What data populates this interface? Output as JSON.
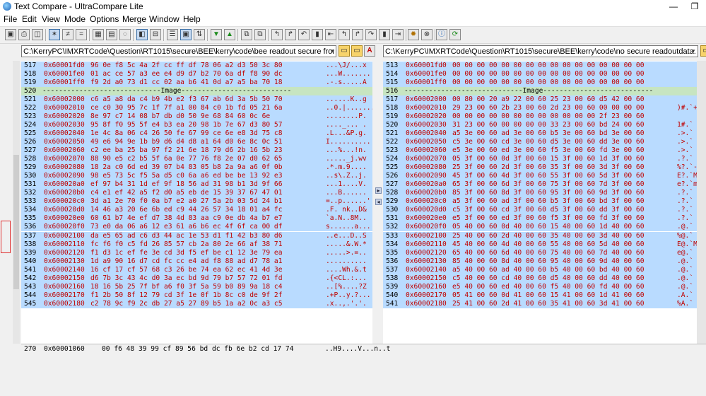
{
  "window": {
    "title": "Text Compare - UltraCompare Lite",
    "restore_glyph": "❐"
  },
  "menu": [
    "File",
    "Edit",
    "View",
    "Mode",
    "Options",
    "Merge",
    "Window",
    "Help"
  ],
  "toolbar": {
    "icons": [
      "save-icon",
      "print-icon",
      "print-preview-icon",
      "show-all-icon",
      "show-differences-icon",
      "show-matches-icon",
      "binary-view-icon",
      "hex-view-icon",
      "ignore-options-icon",
      "side-by-side-icon",
      "over-under-icon",
      "swap-icon",
      "sync-icon",
      "list-view-icon",
      "swap-panes-icon",
      "next-difference-icon",
      "previous-difference-icon",
      "first-difference-icon",
      "copy-left-icon",
      "copy-right-icon",
      "undo-icon",
      "save-left-icon",
      "merge-left-icon",
      "merge-right-icon",
      "lock-icon",
      "open-icon",
      "tools-icon",
      "stop-icon",
      "info-icon",
      "refresh-icon"
    ]
  },
  "left": {
    "path": "C:\\KerryPC\\IMXRTCode\\Question\\RT1015\\secure\\BEE\\kerry\\code\\bee readout secure from 0x60001000len"
  },
  "right": {
    "path": "C:\\KerryPC\\IMXRTCode\\Question\\RT1015\\secure\\BEE\\kerry\\code\\no secure readoutdata.txt"
  },
  "colors": {
    "highlight_row": "#b9dbff",
    "image_row": "#c7e5c1",
    "diff_text": "#c00000"
  },
  "left_rows": [
    {
      "ln": "517",
      "addr": "0x60001fd0",
      "hex": "96 0e f8 5c 4a 2f cc ff df 78 06 a2 d3 50 3c 80",
      "asc": "...\\J/...x",
      "type": "hl"
    },
    {
      "ln": "518",
      "addr": "0x60001fe0",
      "hex": "01 ac ce 57 a3 ee e4 d9 d7 b2 70 6a df f8 90 dc",
      "asc": "...W.......",
      "type": "hl"
    },
    {
      "ln": "519",
      "addr": "0x60001ff0",
      "hex": "f9 2d a0 73 d1 cc 02 aa b6 41 0d a7 a5 ba 70 18",
      "asc": ".-.s.....A",
      "type": "hl"
    },
    {
      "ln": "520",
      "addr": "",
      "hex": "-----------------------------Image---------------------------",
      "asc": "",
      "type": "img"
    },
    {
      "ln": "521",
      "addr": "0x60002000",
      "hex": "c6 a5 a8 da c4 b9 4b e2 f3 67 ab 6d 3a 5b 50 70",
      "asc": "......K..g",
      "type": "hl"
    },
    {
      "ln": "522",
      "addr": "0x60002010",
      "hex": "ce c0 30 95 7c 1f 7f a1 00 84 c0 1b fd 05 21 6a",
      "asc": "..0.|.......",
      "type": "hl"
    },
    {
      "ln": "523",
      "addr": "0x60002020",
      "hex": "8e 97 c7 14 08 b7 db d0 50 9e 68 84 60 0c 6e",
      "asc": "........P.",
      "type": "hl"
    },
    {
      "ln": "524",
      "addr": "0x60002030",
      "hex": "95 8f f0 95 5f e4 b3 ea 20 98 1b 7e 67 d3 80 57",
      "asc": "...._... .",
      "type": "hl"
    },
    {
      "ln": "525",
      "addr": "0x60002040",
      "hex": "1e 4c 8a 06 c4 26 50 fe 67 99 ce 6e e8 3d 75 c8",
      "asc": ".L...&P.g.",
      "type": "hl"
    },
    {
      "ln": "526",
      "addr": "0x60002050",
      "hex": "49 e6 94 9e 1b b9 d6 d4 d8 a1 64 d0 6e 8c 0c 51",
      "asc": "I..........",
      "type": "hl"
    },
    {
      "ln": "527",
      "addr": "0x60002060",
      "hex": "c2 ee ba 25 ba 97 f2 21 6e 18 79 d6 2b 16 5b 23",
      "asc": "...%...!n.",
      "type": "hl"
    },
    {
      "ln": "528",
      "addr": "0x60002070",
      "hex": "88 90 e5 c2 b5 5f 6a 0e 77 76 f8 2e 07 d0 62 65",
      "asc": "....._j.wv",
      "type": "hl"
    },
    {
      "ln": "529",
      "addr": "0x60002080",
      "hex": "18 2a c0 6d ed 39 07 b4 83 05 b8 2a 9a a6 0f 0b",
      "asc": ".*.m.9....",
      "type": "hl"
    },
    {
      "ln": "530",
      "addr": "0x60002090",
      "hex": "98 e5 73 5c f5 5a d5 c0 6a a6 ed be be 13 92 e3",
      "asc": "..s\\.Z..j.",
      "type": "hl"
    },
    {
      "ln": "531",
      "addr": "0x600020a0",
      "hex": "ef 97 b4 31 1d ef 9f 18 56 ad 31 98 b1 3d 9f 66",
      "asc": "...1....V.",
      "type": "hl"
    },
    {
      "ln": "532",
      "addr": "0x600020b0",
      "hex": "c4 e1 ef 42 a5 f2 d0 a5 eb de 15 39 37 67 47 01",
      "asc": "...B......",
      "type": "hl"
    },
    {
      "ln": "533",
      "addr": "0x600020c0",
      "hex": "3d a1 2e 70 f0 0a b7 e2 a0 27 5a 2b 03 5d 24 b1",
      "asc": "=..p......'",
      "type": "hl"
    },
    {
      "ln": "534",
      "addr": "0x600020d0",
      "hex": "14 46 a3 20 6e 6b ed c9 44 26 57 34 18 01 a4 fc",
      "asc": ".F. nk..D&",
      "type": "hl"
    },
    {
      "ln": "535",
      "addr": "0x600020e0",
      "hex": "60 61 b7 4e ef d7 38 4d 83 aa c9 0e db 4a b7 e7",
      "asc": "`a.N..8M..",
      "type": "hl"
    },
    {
      "ln": "536",
      "addr": "0x600020f0",
      "hex": "73 e0 da 06 a6 12 e3 61 a6 b6 ec 4f 6f ca 00 df",
      "asc": "s......a...",
      "type": "hl"
    },
    {
      "ln": "537",
      "addr": "0x60002100",
      "hex": "da e5 65 ad c6 d3 44 ac 1e 53 d1 f1 42 b3 80 d6",
      "asc": "..e...D..S",
      "type": "hl"
    },
    {
      "ln": "538",
      "addr": "0x60002110",
      "hex": "fc f6 f0 c5 fd 26 85 57 cb 2a 80 2e 66 af 38 71",
      "asc": ".....&.W.*",
      "type": "hl"
    },
    {
      "ln": "539",
      "addr": "0x60002120",
      "hex": "f1 d3 1c ef fe 3e cd 3d f5 ef be c1 12 3e 79 ea",
      "asc": ".....>.=..",
      "type": "hl"
    },
    {
      "ln": "540",
      "addr": "0x60002130",
      "hex": "1d a9 90 16 d7 cd fc cc e4 ad f8 88 ad d7 78 a1",
      "asc": "..........",
      "type": "hl"
    },
    {
      "ln": "541",
      "addr": "0x60002140",
      "hex": "16 cf 17 cf 57 68 c3 26 be 74 ea 62 ec 41 4d 3e",
      "asc": "....Wh.&.t",
      "type": "hl"
    },
    {
      "ln": "542",
      "addr": "0x60002150",
      "hex": "d6 7b 3c 43 4c d0 3a ec bd 9d 79 b7 57 72 01 fd",
      "asc": ".{<CL.:...",
      "type": "hl"
    },
    {
      "ln": "543",
      "addr": "0x60002160",
      "hex": "18 16 5b 25 7f bf a6 f0 3f 5a 59 b0 89 9a 18 c4",
      "asc": "..[%....?Z",
      "type": "hl"
    },
    {
      "ln": "544",
      "addr": "0x60002170",
      "hex": "f1 2b 50 8f 12 79 cd 3f 1e 0f 1b 8c c0 de 9f 2f",
      "asc": ".+P..y.?...",
      "type": "hl"
    },
    {
      "ln": "545",
      "addr": "0x60002180",
      "hex": "c2 78 9c f9 2c db 27 a5 27 89 b5 1a a2 0c a3 c5",
      "asc": ".x..,.'.'.",
      "type": "hl"
    }
  ],
  "right_rows": [
    {
      "ln": "513",
      "addr": "0x60001fd0",
      "hex": "00 00 00 00 00 00 00 00 00 00 00 00 00 00 00 00",
      "asc": "",
      "type": "hl"
    },
    {
      "ln": "514",
      "addr": "0x60001fe0",
      "hex": "00 00 00 00 00 00 00 00 00 00 00 00 00 00 00 00",
      "asc": "",
      "type": "hl"
    },
    {
      "ln": "515",
      "addr": "0x60001ff0",
      "hex": "00 00 00 00 00 00 00 00 00 00 00 00 00 00 00 00",
      "asc": "",
      "type": "hl"
    },
    {
      "ln": "516",
      "addr": "",
      "hex": "-----------------------------Image---------------------------",
      "asc": "",
      "type": "img"
    },
    {
      "ln": "517",
      "addr": "0x60002000",
      "hex": "00 80 00 20 a9 22 00 60 25 23 00 60 d5 42 00 60",
      "asc": "",
      "type": "hl"
    },
    {
      "ln": "518",
      "addr": "0x60002010",
      "hex": "29 23 00 60 2b 23 00 60 2d 23 00 60 00 00 00 00",
      "asc": ")#.`+",
      "type": "hl"
    },
    {
      "ln": "519",
      "addr": "0x60002020",
      "hex": "00 00 00 00 00 00 00 00 00 00 00 00 2f 23 00 60",
      "asc": "",
      "type": "hl"
    },
    {
      "ln": "520",
      "addr": "0x60002030",
      "hex": "31 23 00 60 00 00 00 00 33 23 00 60 bd 24 00 60",
      "asc": "1#.`",
      "type": "hl"
    },
    {
      "ln": "521",
      "addr": "0x60002040",
      "hex": "a5 3e 00 60 ad 3e 00 60 b5 3e 00 60 bd 3e 00 60",
      "asc": ".>.`",
      "type": "hl"
    },
    {
      "ln": "522",
      "addr": "0x60002050",
      "hex": "c5 3e 00 60 cd 3e 00 60 d5 3e 00 60 dd 3e 00 60",
      "asc": ".>.`",
      "type": "hl"
    },
    {
      "ln": "523",
      "addr": "0x60002060",
      "hex": "e5 3e 00 60 ed 3e 00 60 f5 3e 00 60 fd 3e 00 60",
      "asc": ".>.`",
      "type": "hl"
    },
    {
      "ln": "524",
      "addr": "0x60002070",
      "hex": "05 3f 00 60 0d 3f 00 60 15 3f 00 60 1d 3f 00 60",
      "asc": ".?.`",
      "type": "hl"
    },
    {
      "ln": "525",
      "addr": "0x60002080",
      "hex": "25 3f 00 60 2d 3f 00 60 35 3f 00 60 3d 3f 00 60",
      "asc": "%?.`-",
      "type": "hl"
    },
    {
      "ln": "526",
      "addr": "0x60002090",
      "hex": "45 3f 00 60 4d 3f 00 60 55 3f 00 60 5d 3f 00 60",
      "asc": "E?.`M",
      "type": "hl"
    },
    {
      "ln": "527",
      "addr": "0x600020a0",
      "hex": "65 3f 00 60 6d 3f 00 60 75 3f 00 60 7d 3f 00 60",
      "asc": "e?.`m",
      "type": "hl"
    },
    {
      "ln": "528",
      "addr": "0x600020b0",
      "hex": "85 3f 00 60 8d 3f 00 60 95 3f 00 60 9d 3f 00 60",
      "asc": ".?.`",
      "type": "hl"
    },
    {
      "ln": "529",
      "addr": "0x600020c0",
      "hex": "a5 3f 00 60 ad 3f 00 60 b5 3f 00 60 bd 3f 00 60",
      "asc": ".?.`",
      "type": "hl"
    },
    {
      "ln": "530",
      "addr": "0x600020d0",
      "hex": "c5 3f 00 60 cd 3f 00 60 d5 3f 00 60 dd 3f 00 60",
      "asc": ".?.`",
      "type": "hl"
    },
    {
      "ln": "531",
      "addr": "0x600020e0",
      "hex": "e5 3f 00 60 ed 3f 00 60 f5 3f 00 60 fd 3f 00 60",
      "asc": ".?.`",
      "type": "hl"
    },
    {
      "ln": "532",
      "addr": "0x600020f0",
      "hex": "05 40 00 60 0d 40 00 60 15 40 00 60 1d 40 00 60",
      "asc": ".@.`",
      "type": "hl"
    },
    {
      "ln": "533",
      "addr": "0x60002100",
      "hex": "25 40 00 60 2d 40 00 60 35 40 00 60 3d 40 00 60",
      "asc": "%@.`",
      "type": "hl"
    },
    {
      "ln": "534",
      "addr": "0x60002110",
      "hex": "45 40 00 60 4d 40 00 60 55 40 00 60 5d 40 00 60",
      "asc": "E@.`M",
      "type": "hl"
    },
    {
      "ln": "535",
      "addr": "0x60002120",
      "hex": "65 40 00 60 6d 40 00 60 75 40 00 60 7d 40 00 60",
      "asc": "e@.`",
      "type": "hl"
    },
    {
      "ln": "536",
      "addr": "0x60002130",
      "hex": "85 40 00 60 8d 40 00 60 95 40 00 60 9d 40 00 60",
      "asc": ".@.`",
      "type": "hl"
    },
    {
      "ln": "537",
      "addr": "0x60002140",
      "hex": "a5 40 00 60 ad 40 00 60 b5 40 00 60 bd 40 00 60",
      "asc": ".@.`",
      "type": "hl"
    },
    {
      "ln": "538",
      "addr": "0x60002150",
      "hex": "c5 40 00 60 cd 40 00 60 d5 40 00 60 dd 40 00 60",
      "asc": ".@.`",
      "type": "hl"
    },
    {
      "ln": "539",
      "addr": "0x60002160",
      "hex": "e5 40 00 60 ed 40 00 60 f5 40 00 60 fd 40 00 60",
      "asc": ".@.`",
      "type": "hl"
    },
    {
      "ln": "540",
      "addr": "0x60002170",
      "hex": "05 41 00 60 0d 41 00 60 15 41 00 60 1d 41 00 60",
      "asc": ".A.`",
      "type": "hl"
    },
    {
      "ln": "541",
      "addr": "0x60002180",
      "hex": "25 41 00 60 2d 41 00 60 35 41 00 60 3d 41 00 60",
      "asc": "%A.`",
      "type": "hl"
    }
  ],
  "status": {
    "ln": "270",
    "addr": "0x60001060",
    "hex": "00 f6 48 39 99 cf 89 56 bd dc fb 6e b2 cd 17 74",
    "asc": "..H9....V...n..t"
  }
}
